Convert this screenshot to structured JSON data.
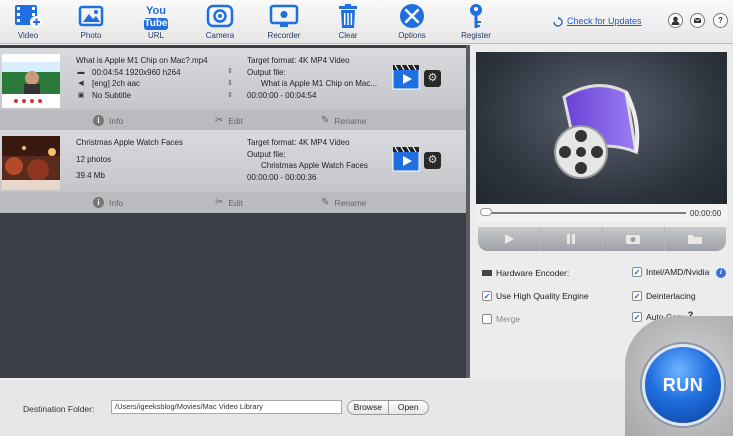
{
  "toolbar": {
    "items": [
      {
        "label": "Video"
      },
      {
        "label": "Photo"
      },
      {
        "label": "URL"
      },
      {
        "label": "Camera"
      },
      {
        "label": "Recorder"
      },
      {
        "label": "Clear"
      },
      {
        "label": "Options"
      },
      {
        "label": "Register"
      }
    ],
    "youtube_top": "You",
    "youtube_bottom": "Tube",
    "check_updates": "Check for Updates"
  },
  "items": [
    {
      "title": "What is Apple M1 Chip on Mac?.mp4",
      "line2": "00:04:54 1920x960 h264",
      "line3": "[eng] 2ch aac",
      "line4": "No Subtitle",
      "target_format": "Target format: 4K MP4 Video",
      "output_label": "Output file:",
      "output_name": "What is Apple M1 Chip on Mac...",
      "output_time": "00:00:00 - 00:04:54",
      "actions": {
        "info": "Info",
        "edit": "Edit",
        "rename": "Rename"
      }
    },
    {
      "title": "Christmas Apple Watch Faces",
      "line2": "12 photos",
      "line3": "39.4 Mb",
      "target_format": "Target format: 4K MP4 Video",
      "output_label": "Output file:",
      "output_name": "Christmas Apple Watch Faces",
      "output_time": "00:00:00 - 00:00:36",
      "actions": {
        "info": "Info",
        "edit": "Edit",
        "rename": "Rename"
      }
    }
  ],
  "player": {
    "time": "00:00:00"
  },
  "options": {
    "hardware_encoder": "Hardware Encoder:",
    "intel_nvidia": "Intel/AMD/Nvidia",
    "high_quality": "Use High Quality Engine",
    "deinterlacing": "Deinterlacing",
    "merge": "Merge",
    "auto_copy": "Auto Copy",
    "auto_copy_q": "?"
  },
  "run_label": "RUN",
  "destination": {
    "label": "Destination Folder:",
    "path": "/Users/igeeksblog/Movies/Mac Video Library",
    "browse": "Browse",
    "open": "Open"
  },
  "colors": {
    "accent": "#1f6fe0",
    "toolbar_text": "#233a6a",
    "link": "#1f5fb8"
  }
}
